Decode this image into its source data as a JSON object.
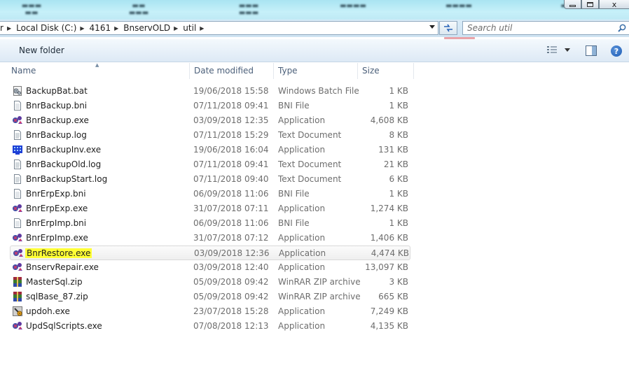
{
  "window": {
    "close_label": "x"
  },
  "address": {
    "crumbs": [
      "r",
      "Local Disk (C:)",
      "4161",
      "BnservOLD",
      "util"
    ]
  },
  "search": {
    "placeholder": "Search util"
  },
  "toolbar": {
    "new_folder_label": "New folder",
    "help_label": "?"
  },
  "columns": {
    "name": "Name",
    "date_modified": "Date modified",
    "type": "Type",
    "size": "Size"
  },
  "files": [
    {
      "name": "BackupBat.bat",
      "date": "19/06/2018 15:58",
      "type": "Windows Batch File",
      "size": "1 KB",
      "icon": "batch-file-icon"
    },
    {
      "name": "BnrBackup.bni",
      "date": "07/11/2018 09:41",
      "type": "BNI File",
      "size": "1 KB",
      "icon": "generic-file-icon"
    },
    {
      "name": "BnrBackup.exe",
      "date": "03/09/2018 12:35",
      "type": "Application",
      "size": "4,608 KB",
      "icon": "application-icon"
    },
    {
      "name": "BnrBackup.log",
      "date": "07/11/2018 15:29",
      "type": "Text Document",
      "size": "8 KB",
      "icon": "text-document-icon"
    },
    {
      "name": "BnrBackupInv.exe",
      "date": "19/06/2018 16:04",
      "type": "Application",
      "size": "131 KB",
      "icon": "blue-application-icon"
    },
    {
      "name": "BnrBackupOld.log",
      "date": "07/11/2018 09:41",
      "type": "Text Document",
      "size": "21 KB",
      "icon": "text-document-icon"
    },
    {
      "name": "BnrBackupStart.log",
      "date": "07/11/2018 09:40",
      "type": "Text Document",
      "size": "6 KB",
      "icon": "text-document-icon"
    },
    {
      "name": "BnrErpExp.bni",
      "date": "06/09/2018 11:06",
      "type": "BNI File",
      "size": "1 KB",
      "icon": "generic-file-icon"
    },
    {
      "name": "BnrErpExp.exe",
      "date": "31/07/2018 07:11",
      "type": "Application",
      "size": "1,274 KB",
      "icon": "application-icon"
    },
    {
      "name": "BnrErpImp.bni",
      "date": "06/09/2018 11:06",
      "type": "BNI File",
      "size": "1 KB",
      "icon": "generic-file-icon"
    },
    {
      "name": "BnrErpImp.exe",
      "date": "31/07/2018 07:12",
      "type": "Application",
      "size": "1,406 KB",
      "icon": "application-icon"
    },
    {
      "name": "BnrRestore.exe",
      "date": "03/09/2018 12:36",
      "type": "Application",
      "size": "4,474 KB",
      "icon": "application-icon",
      "selected": true,
      "highlighted": true
    },
    {
      "name": "BnservRepair.exe",
      "date": "03/09/2018 12:40",
      "type": "Application",
      "size": "13,097 KB",
      "icon": "application-icon"
    },
    {
      "name": "MasterSql.zip",
      "date": "05/09/2018 09:42",
      "type": "WinRAR ZIP archive",
      "size": "3 KB",
      "icon": "winrar-archive-icon"
    },
    {
      "name": "sqlBase_87.zip",
      "date": "05/09/2018 09:42",
      "type": "WinRAR ZIP archive",
      "size": "665 KB",
      "icon": "winrar-archive-icon"
    },
    {
      "name": "updoh.exe",
      "date": "23/07/2018 15:28",
      "type": "Application",
      "size": "7,249 KB",
      "icon": "installer-icon"
    },
    {
      "name": "UpdSqlScripts.exe",
      "date": "07/08/2018 12:13",
      "type": "Application",
      "size": "4,135 KB",
      "icon": "application-icon"
    }
  ],
  "colors": {
    "highlight": "#ffff35",
    "address_bg": "#d5e8f6",
    "toolbar_bg": "#e8f1fa",
    "header_text": "#4c607a",
    "detail_text": "#6d6d6d"
  }
}
